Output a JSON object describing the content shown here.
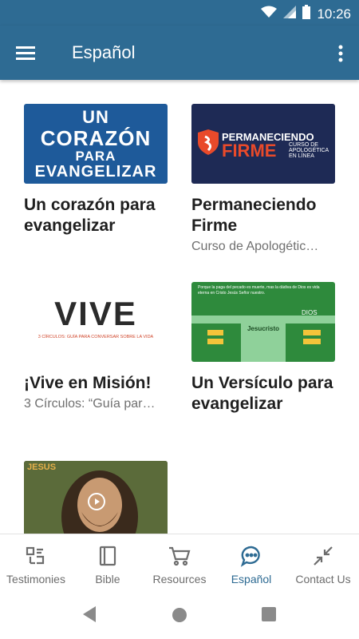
{
  "status_bar": {
    "time": "10:26"
  },
  "app_bar": {
    "title": "Español"
  },
  "cards": [
    {
      "thumb_text": [
        "UN",
        "CORAZÓN",
        "PARA",
        "EVANGELIZAR"
      ],
      "title": "Un corazón para evangelizar",
      "subtitle": ""
    },
    {
      "thumb_text": [
        "PERMANECIENDO",
        "FIRME",
        "CURSO DE",
        "APOLOGÉTICA",
        "EN LÍNEA"
      ],
      "title": "Permaneciendo Firme",
      "subtitle": "Curso de Apologétic…"
    },
    {
      "thumb_text": [
        "VIVE",
        "3 CÍRCULOS: GUÍA PARA CONVERSAR SOBRE LA VIDA"
      ],
      "title": "¡Vive en Misión!",
      "subtitle": "3 Círculos: “Guía par…"
    },
    {
      "thumb_text": [
        "Jesucristo",
        "DIOS",
        "Porque la paga del pecado es muerte, mas la dádiva de Dios es vida eterna en Cristo Jesús Señor nuestro."
      ],
      "title": "Un Versículo para evangelizar",
      "subtitle": ""
    },
    {
      "thumb_text": [
        "JESUS"
      ],
      "title": "",
      "subtitle": ""
    }
  ],
  "bottom_nav": [
    {
      "label": "Testimonies",
      "icon": "testimonies-icon",
      "active": false
    },
    {
      "label": "Bible",
      "icon": "bible-icon",
      "active": false
    },
    {
      "label": "Resources",
      "icon": "cart-icon",
      "active": false
    },
    {
      "label": "Español",
      "icon": "chat-icon",
      "active": true
    },
    {
      "label": "Contact Us",
      "icon": "shrink-arrows-icon",
      "active": false
    }
  ],
  "colors": {
    "primary": "#2e6b93",
    "active_nav": "#2e6b93",
    "inactive_nav": "#6d6d6d"
  }
}
